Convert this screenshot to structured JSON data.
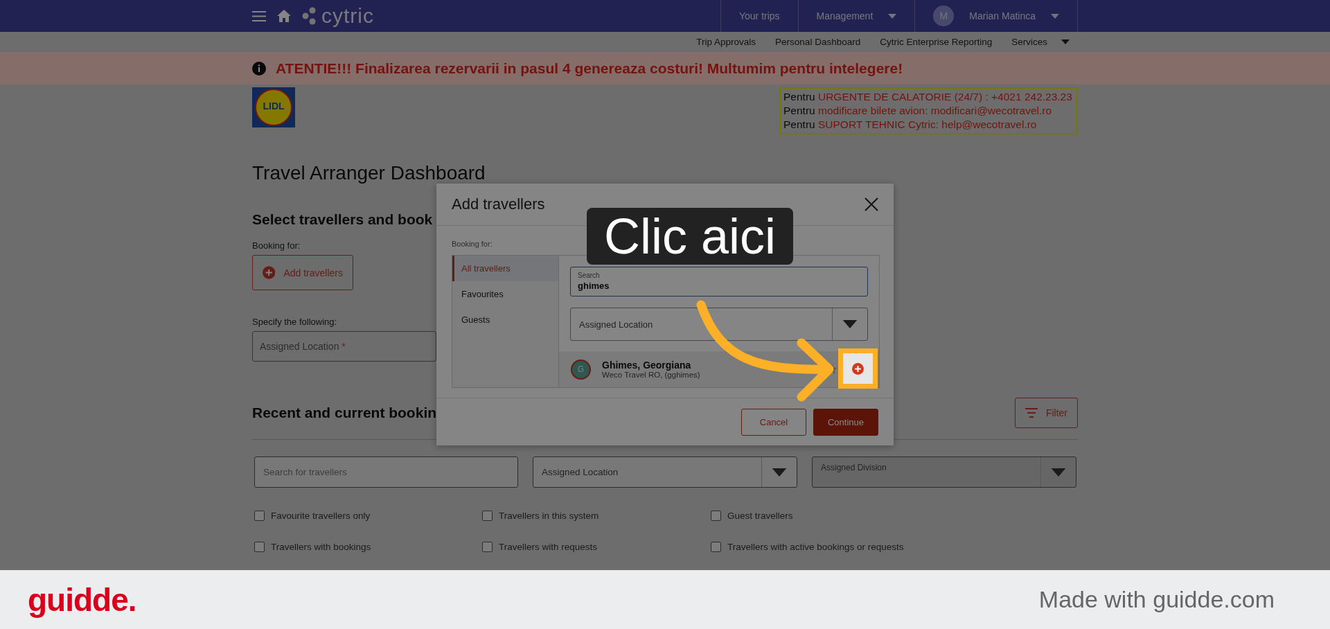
{
  "top_nav": {
    "logo": "cytric",
    "items": [
      {
        "label": "Your trips",
        "dropdown": false
      },
      {
        "label": "Management",
        "dropdown": true
      }
    ],
    "user": {
      "initial": "M",
      "name": "Marian Matinca"
    }
  },
  "sub_nav": [
    {
      "label": "Trip Approvals",
      "dropdown": false
    },
    {
      "label": "Personal Dashboard",
      "dropdown": false
    },
    {
      "label": "Cytric Enterprise Reporting",
      "dropdown": false
    },
    {
      "label": "Services",
      "dropdown": true
    }
  ],
  "banner": "ATENTIE!!! Finalizarea rezervarii in pasul 4 genereaza costuri! Multumim pentru intelegere!",
  "company_logo": "LIDL",
  "contacts": [
    {
      "lead": "Pentru",
      "text": "URGENTE DE CALATORIE (24/7) : +4021 242.23.23"
    },
    {
      "lead": "Pentru",
      "text": "modificare bilete avion:  modificari@wecotravel.ro"
    },
    {
      "lead": "Pentru",
      "text": "SUPORT TEHNIC Cytric:  help@wecotravel.ro"
    }
  ],
  "page_title": "Travel Arranger Dashboard",
  "select_section": {
    "heading": "Select travellers and book",
    "booking_label": "Booking for:",
    "add_button": "Add travellers",
    "specify_label": "Specify the following:",
    "location_placeholder": "Assigned Location",
    "required_mark": "*"
  },
  "bookings_section": {
    "heading": "Recent and current bookin",
    "filter_button": "Filter",
    "search_placeholder": "Search for travellers",
    "location_placeholder": "Assigned Location",
    "division_label": "Assigned Division",
    "checkboxes": [
      {
        "label": "Favourite travellers only",
        "checked": false
      },
      {
        "label": "Travellers in this system",
        "checked": false
      },
      {
        "label": "Guest travellers",
        "checked": false
      },
      {
        "label": "Travellers with bookings",
        "checked": false
      },
      {
        "label": "Travellers with requests",
        "checked": false
      },
      {
        "label": "Travellers with active bookings or requests",
        "checked": false
      }
    ]
  },
  "dialog": {
    "title": "Add travellers",
    "booking_label": "Booking for:",
    "tabs": [
      {
        "label": "All travellers",
        "selected": true
      },
      {
        "label": "Favourites",
        "selected": false
      },
      {
        "label": "Guests",
        "selected": false
      }
    ],
    "search": {
      "label": "Search",
      "value": "ghimes"
    },
    "location_placeholder": "Assigned Location",
    "results": [
      {
        "initial": "G",
        "name": "Ghimes, Georgiana",
        "detail": "Weco Travel RO, (gghimes)",
        "favourite": false
      }
    ],
    "buttons": [
      {
        "label": "Cancel",
        "kind": "secondary"
      },
      {
        "label": "Continue",
        "kind": "primary"
      }
    ]
  },
  "callout": "Clic aici",
  "footer": {
    "brand": "guidde.",
    "tagline": "Made with guidde.com"
  }
}
